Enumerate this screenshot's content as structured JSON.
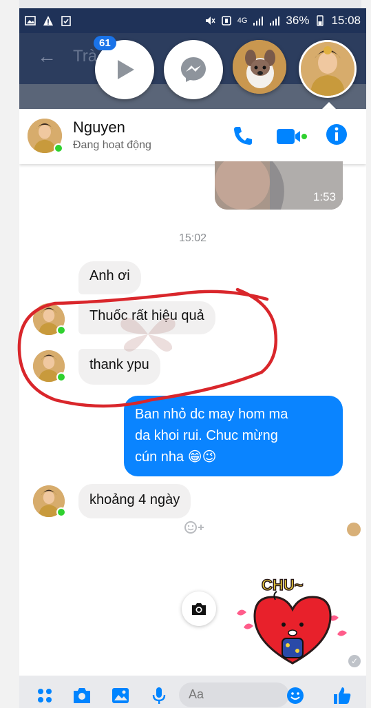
{
  "status_bar": {
    "time": "15:08",
    "battery": "36%",
    "network": "4G"
  },
  "header": {
    "back_icon": "arrow-left-icon",
    "title_partial": "Trà"
  },
  "chat_heads": {
    "badge_count": "61"
  },
  "chat_header": {
    "name": "Nguyen",
    "status": "Đang hoạt động"
  },
  "video_message": {
    "duration": "1:53"
  },
  "messages": {
    "time_separator": "15:02",
    "m1": "Anh ơi",
    "m2": "Thuốc rất hiệu quả",
    "m3": "thank ypu",
    "m4_line1": "Ban nhỏ dc may hom ma",
    "m4_line2": "da khoi rui. Chuc mừng",
    "m4_line3": "cún nha 😁😉",
    "m5": "khoảng 4 ngày"
  },
  "sticker": {
    "text": "CHU~"
  },
  "composer": {
    "placeholder": "Aa"
  },
  "colors": {
    "status_bar": "#1f3258",
    "outgoing_bubble": "#0a84ff",
    "incoming_bubble": "#f1f0f0",
    "online_dot": "#2fd12f",
    "annotation_red": "#d9262b",
    "messenger_blue": "#0084ff"
  }
}
